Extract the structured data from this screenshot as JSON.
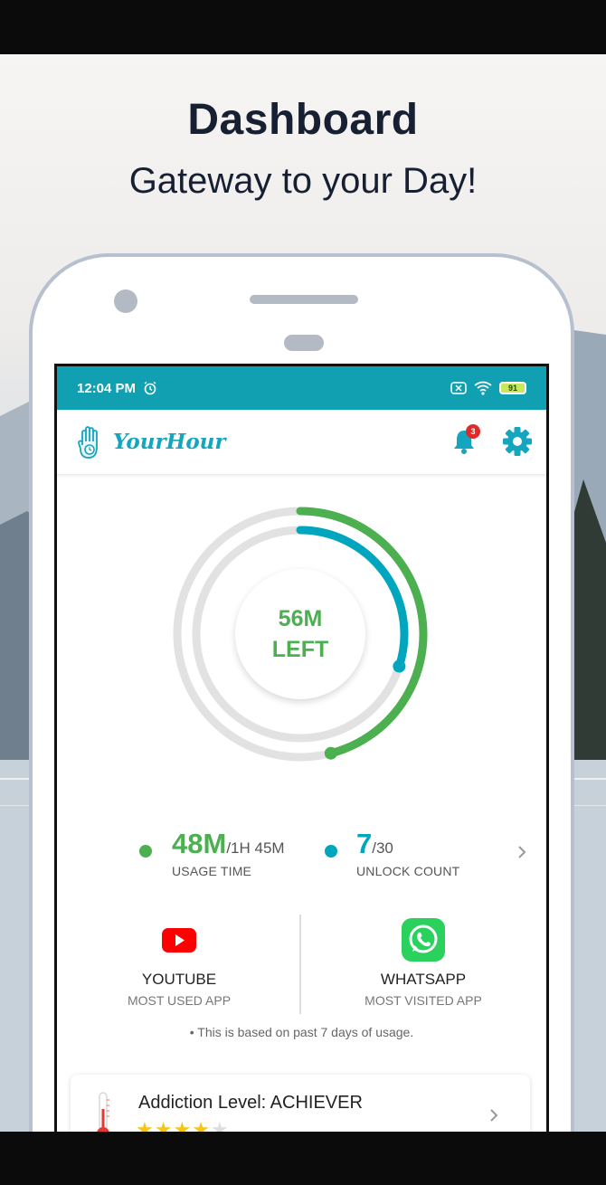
{
  "promo": {
    "title": "Dashboard",
    "subtitle": "Gateway to your Day!"
  },
  "statusbar": {
    "time": "12:04 PM",
    "battery": "91",
    "color": "#11a0b1"
  },
  "appbar": {
    "brand": "YourHour",
    "notification_count": "3",
    "accent": "#13a6be"
  },
  "ring": {
    "time_left_value": "56M",
    "time_left_label": "LEFT",
    "outer_progress_fraction": 0.46,
    "inner_progress_fraction": 0.3,
    "outer_color": "#4caf50",
    "inner_color": "#00a6be"
  },
  "stats": {
    "usage": {
      "value": "48M",
      "total": "/1H 45M",
      "label": "USAGE TIME",
      "color": "#4caf50"
    },
    "unlocks": {
      "value": "7",
      "total": "/30",
      "label": "UNLOCK COUNT",
      "color": "#00a6be"
    }
  },
  "apps": {
    "most_used": {
      "name": "YOUTUBE",
      "caption": "MOST USED APP",
      "icon": "youtube-icon"
    },
    "most_visited": {
      "name": "WHATSAPP",
      "caption": "MOST VISITED APP",
      "icon": "whatsapp-icon"
    },
    "note": "• This is based on past 7 days of usage."
  },
  "addiction": {
    "title": "Addiction Level: ACHIEVER",
    "rating": 4,
    "max_rating": 5
  }
}
